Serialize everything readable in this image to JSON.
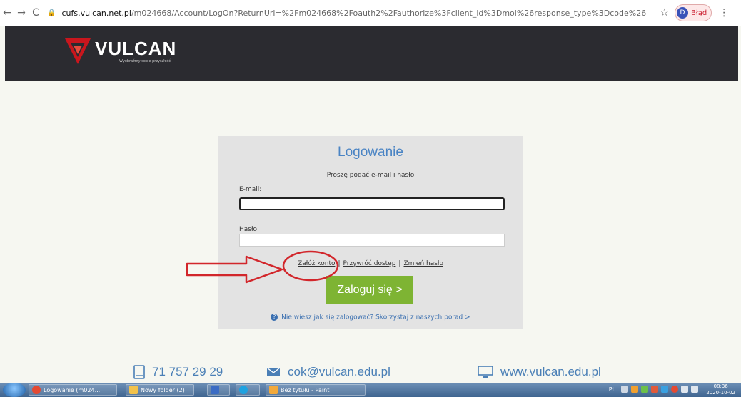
{
  "browser": {
    "url_host": "cufs.vulcan.net.pl",
    "url_rest": "/m024668/Account/LogOn?ReturnUrl=%2Fm024668%2Foauth2%2Fauthorize%3Fclient_id%3Dmol%26response_type%3Dcode%26redirect_uri%3Dhttp%2...",
    "profile_initial": "D",
    "profile_label": "Błąd"
  },
  "header": {
    "logo_text": "VULCAN",
    "logo_subtitle": "Wyobraźmy sobie przyszłość"
  },
  "login": {
    "title": "Logowanie",
    "subtitle": "Proszę podać e-mail i hasło",
    "email_label": "E-mail:",
    "email_value": "",
    "password_label": "Hasło:",
    "password_value": "",
    "links": [
      "Załóż konto",
      "Przywróć dostęp",
      "Zmień hasło"
    ],
    "link_separator": "|",
    "submit_label": "Zaloguj się >",
    "help_prefix": "Nie wiesz jak się zalogować?",
    "help_link": "Skorzystaj z naszych porad",
    "help_suffix": ">"
  },
  "contacts": {
    "phone": "71 757 29 29",
    "email": "cok@vulcan.edu.pl",
    "website": "www.vulcan.edu.pl"
  },
  "taskbar": {
    "tasks": [
      {
        "label": "Logowanie (m024...",
        "color": "#e34a33"
      },
      {
        "label": "Nowy folder (2)",
        "color": "#f2c24b"
      },
      {
        "label": "",
        "color": "#3b6cc4"
      },
      {
        "label": "",
        "color": "#1fa2e0"
      },
      {
        "label": "Bez tytułu - Paint",
        "color": "#f2a93b"
      }
    ],
    "language": "PL",
    "time": "08:36",
    "date": "2020-10-02"
  },
  "colors": {
    "accent_blue": "#4a84c4",
    "button_green": "#7eb433",
    "header_dark": "#2b2b30",
    "annotation_red": "#d2262b"
  }
}
